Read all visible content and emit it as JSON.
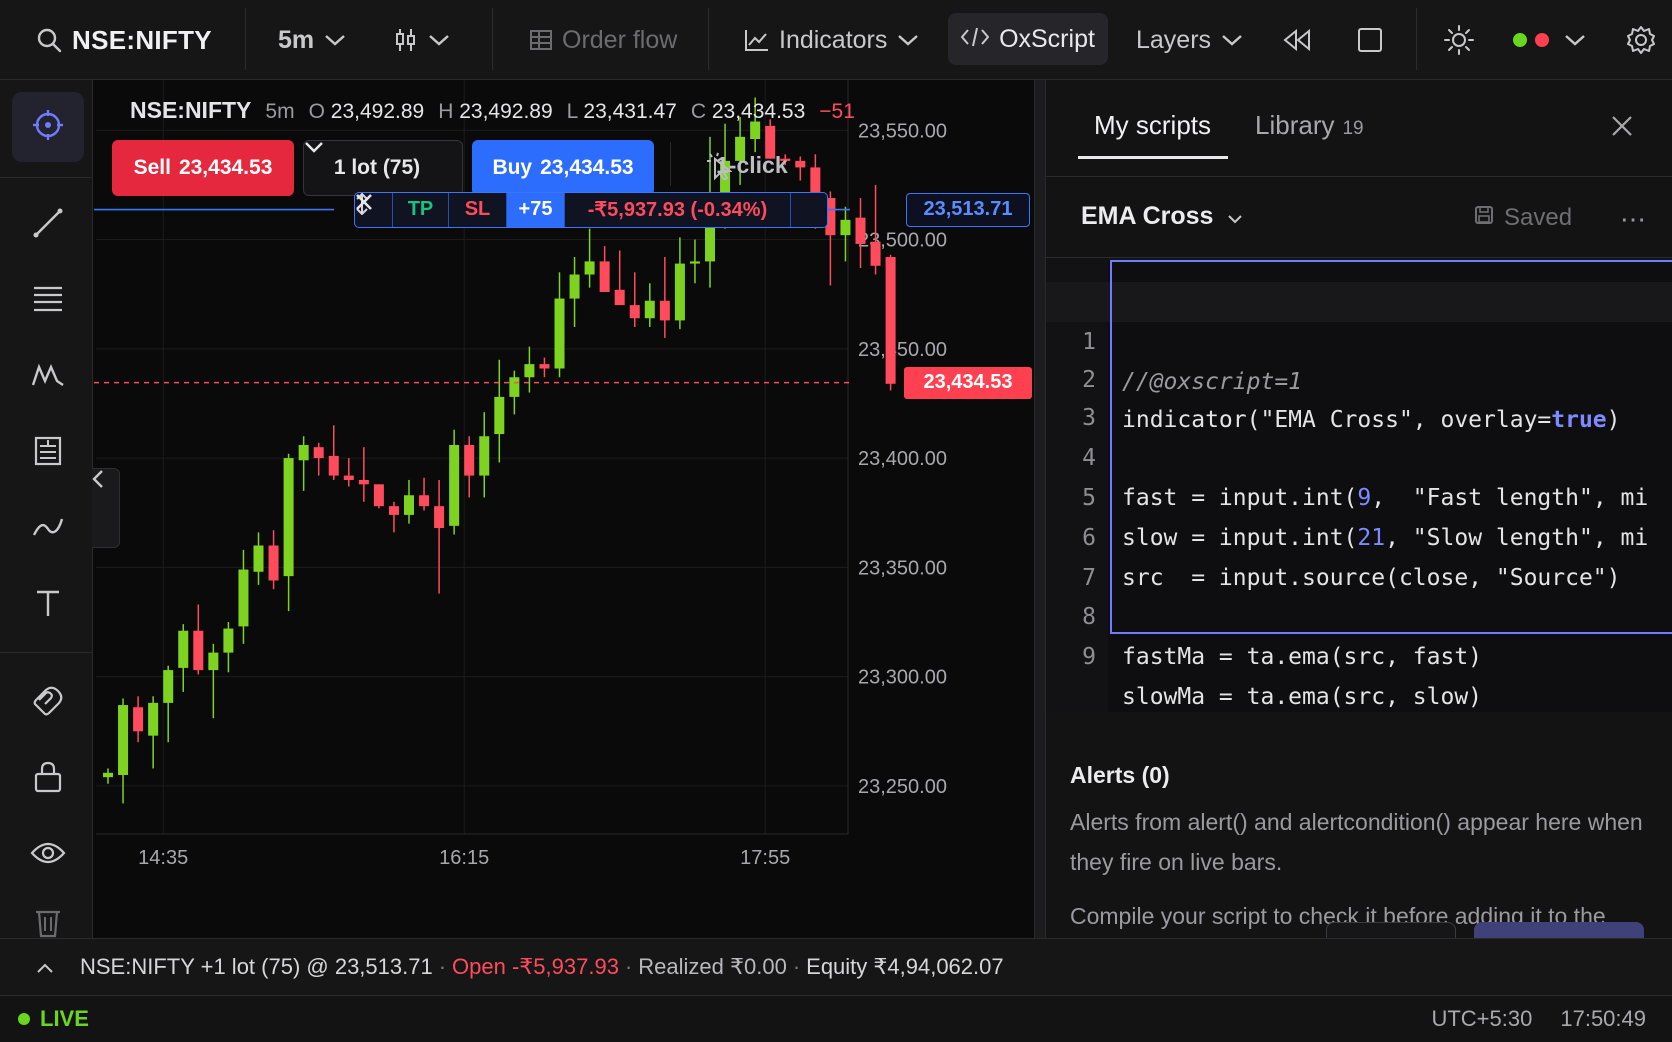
{
  "toolbar": {
    "symbol": "NSE:NIFTY",
    "interval": "5m",
    "order_flow": "Order flow",
    "indicators": "Indicators",
    "oxscript": "OxScript",
    "layers": "Layers"
  },
  "chart": {
    "legend": {
      "symbol": "NSE:NIFTY",
      "interval": "5m",
      "open_label": "O",
      "open": "23,492.89",
      "high_label": "H",
      "high": "23,492.89",
      "low_label": "L",
      "low": "23,431.47",
      "close_label": "C",
      "close": "23,434.53",
      "change": "−51"
    },
    "trade": {
      "sell_label": "Sell",
      "sell_price": "23,434.53",
      "lot": "1 lot (75)",
      "buy_label": "Buy",
      "buy_price": "23,434.53",
      "one_click": "1-click"
    },
    "position_bar": {
      "tp": "TP",
      "sl": "SL",
      "qty": "+75",
      "pnl": "-₹5,937.93 (-0.34%)"
    },
    "entry_price_tag": "23,513.71",
    "last_price_tag": "23,434.53",
    "colors": {
      "up": "#7ed321",
      "down": "#ff4b5c",
      "entry_line": "#3b74ff"
    }
  },
  "chart_data": {
    "type": "candlestick",
    "title": "",
    "y_ticks": [
      "23,550.00",
      "23,500.00",
      "23,450.00",
      "23,400.00",
      "23,350.00",
      "23,300.00",
      "23,250.00"
    ],
    "x_ticks": [
      "14:35",
      "16:15",
      "17:55"
    ],
    "ylim": [
      23228,
      23573
    ],
    "entry_price": 23513.71,
    "last_price": 23434.53,
    "candles": [
      {
        "o": 23254,
        "h": 23258,
        "l": 23251,
        "c": 23256
      },
      {
        "o": 23255,
        "h": 23290,
        "l": 23242,
        "c": 23287
      },
      {
        "o": 23286,
        "h": 23291,
        "l": 23270,
        "c": 23275
      },
      {
        "o": 23273,
        "h": 23291,
        "l": 23258,
        "c": 23288
      },
      {
        "o": 23288,
        "h": 23305,
        "l": 23270,
        "c": 23303
      },
      {
        "o": 23304,
        "h": 23324,
        "l": 23293,
        "c": 23321
      },
      {
        "o": 23321,
        "h": 23333,
        "l": 23301,
        "c": 23303
      },
      {
        "o": 23303,
        "h": 23315,
        "l": 23281,
        "c": 23311
      },
      {
        "o": 23311,
        "h": 23325,
        "l": 23302,
        "c": 23322
      },
      {
        "o": 23323,
        "h": 23358,
        "l": 23315,
        "c": 23349
      },
      {
        "o": 23348,
        "h": 23366,
        "l": 23342,
        "c": 23360
      },
      {
        "o": 23360,
        "h": 23367,
        "l": 23340,
        "c": 23344
      },
      {
        "o": 23346,
        "h": 23402,
        "l": 23330,
        "c": 23400
      },
      {
        "o": 23399,
        "h": 23410,
        "l": 23385,
        "c": 23406
      },
      {
        "o": 23405,
        "h": 23407,
        "l": 23392,
        "c": 23400
      },
      {
        "o": 23401,
        "h": 23415,
        "l": 23390,
        "c": 23392
      },
      {
        "o": 23392,
        "h": 23400,
        "l": 23387,
        "c": 23390
      },
      {
        "o": 23390,
        "h": 23405,
        "l": 23380,
        "c": 23388
      },
      {
        "o": 23388,
        "h": 23388,
        "l": 23377,
        "c": 23378
      },
      {
        "o": 23378,
        "h": 23380,
        "l": 23366,
        "c": 23374
      },
      {
        "o": 23374,
        "h": 23390,
        "l": 23370,
        "c": 23383
      },
      {
        "o": 23383,
        "h": 23391,
        "l": 23376,
        "c": 23378
      },
      {
        "o": 23378,
        "h": 23390,
        "l": 23338,
        "c": 23368
      },
      {
        "o": 23369,
        "h": 23413,
        "l": 23365,
        "c": 23406
      },
      {
        "o": 23406,
        "h": 23410,
        "l": 23382,
        "c": 23392
      },
      {
        "o": 23392,
        "h": 23421,
        "l": 23382,
        "c": 23410
      },
      {
        "o": 23411,
        "h": 23445,
        "l": 23398,
        "c": 23428
      },
      {
        "o": 23428,
        "h": 23440,
        "l": 23420,
        "c": 23437
      },
      {
        "o": 23437,
        "h": 23451,
        "l": 23430,
        "c": 23443
      },
      {
        "o": 23443,
        "h": 23446,
        "l": 23437,
        "c": 23441
      },
      {
        "o": 23441,
        "h": 23485,
        "l": 23437,
        "c": 23473
      },
      {
        "o": 23473,
        "h": 23492,
        "l": 23460,
        "c": 23484
      },
      {
        "o": 23484,
        "h": 23505,
        "l": 23478,
        "c": 23490
      },
      {
        "o": 23490,
        "h": 23497,
        "l": 23480,
        "c": 23476
      },
      {
        "o": 23477,
        "h": 23495,
        "l": 23470,
        "c": 23470
      },
      {
        "o": 23470,
        "h": 23485,
        "l": 23460,
        "c": 23464
      },
      {
        "o": 23464,
        "h": 23480,
        "l": 23460,
        "c": 23472
      },
      {
        "o": 23472,
        "h": 23492,
        "l": 23455,
        "c": 23463
      },
      {
        "o": 23463,
        "h": 23501,
        "l": 23459,
        "c": 23489
      },
      {
        "o": 23489,
        "h": 23500,
        "l": 23480,
        "c": 23490
      },
      {
        "o": 23490,
        "h": 23547,
        "l": 23478,
        "c": 23511
      },
      {
        "o": 23511,
        "h": 23553,
        "l": 23505,
        "c": 23536
      },
      {
        "o": 23536,
        "h": 23556,
        "l": 23525,
        "c": 23547
      },
      {
        "o": 23546,
        "h": 23565,
        "l": 23540,
        "c": 23554
      },
      {
        "o": 23552,
        "h": 23555,
        "l": 23537,
        "c": 23537
      },
      {
        "o": 23537,
        "h": 23539,
        "l": 23534,
        "c": 23536
      },
      {
        "o": 23536,
        "h": 23538,
        "l": 23527,
        "c": 23533
      },
      {
        "o": 23533,
        "h": 23539,
        "l": 23505,
        "c": 23520
      },
      {
        "o": 23519,
        "h": 23522,
        "l": 23479,
        "c": 23502
      },
      {
        "o": 23502,
        "h": 23515,
        "l": 23490,
        "c": 23509
      },
      {
        "o": 23510,
        "h": 23519,
        "l": 23487,
        "c": 23498
      },
      {
        "o": 23499,
        "h": 23525,
        "l": 23484,
        "c": 23488
      },
      {
        "o": 23492,
        "h": 23493,
        "l": 23431,
        "c": 23434
      }
    ]
  },
  "panel": {
    "tab_my_scripts": "My scripts",
    "tab_library": "Library",
    "library_count": "19",
    "script_name": "EMA Cross",
    "saved": "Saved",
    "more": "⋯",
    "code_lines": [
      "//@oxscript=1",
      "indicator(\"EMA Cross\", overlay=true)",
      "",
      "fast = input.int(9,  \"Fast length\", mi",
      "slow = input.int(21, \"Slow length\", mi",
      "src  = input.source(close, \"Source\")",
      "",
      "fastMa = ta.ema(src, fast)",
      "slowMa = ta.ema(src, slow)"
    ],
    "line_numbers": [
      "1",
      "2",
      "3",
      "4",
      "5",
      "6",
      "7",
      "8",
      "9"
    ],
    "alerts_title": "Alerts (0)",
    "alerts_text": "Alerts from alert() and alertcondition() appear here when they fire on live bars.",
    "compile_text": "Compile your script to check it before adding it to the chart."
  },
  "position_status": {
    "position": "NSE:NIFTY +1 lot (75) @ 23,513.71",
    "sep": "·",
    "open": "Open -₹5,937.93",
    "realized": "Realized ₹0.00",
    "equity": "Equity ₹4,94,062.07"
  },
  "status": {
    "live": "LIVE",
    "timezone": "UTC+5:30",
    "time": "17:50:49"
  }
}
